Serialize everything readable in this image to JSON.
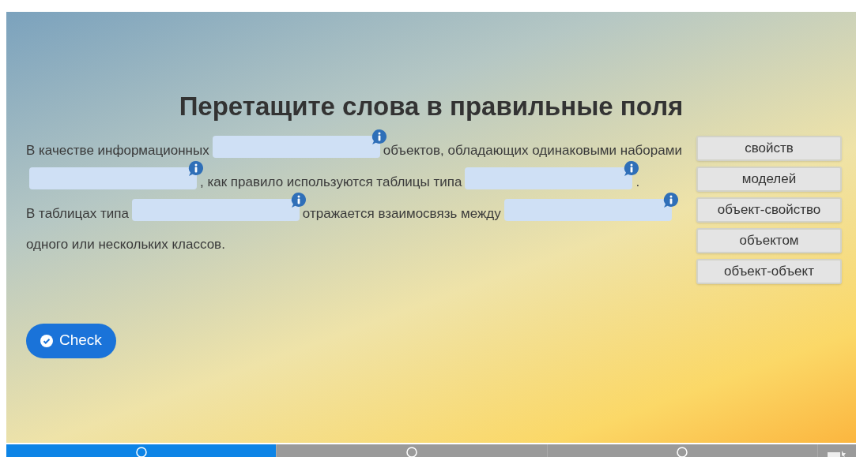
{
  "title": "Перетащите слова в правильные поля",
  "paragraphs": [
    [
      {
        "kind": "text",
        "text": "В качестве информационных"
      },
      {
        "kind": "blank"
      },
      {
        "kind": "text",
        "text": "объектов, обладающих одинаковыми наборами"
      },
      {
        "kind": "blank"
      },
      {
        "kind": "text",
        "text": ", как правило используются таблицы типа"
      },
      {
        "kind": "blank"
      },
      {
        "kind": "text",
        "text": "."
      }
    ],
    [
      {
        "kind": "text",
        "text": "В таблицах типа"
      },
      {
        "kind": "blank"
      },
      {
        "kind": "text",
        "text": "отражается взаимосвязь между"
      },
      {
        "kind": "blank"
      },
      {
        "kind": "text",
        "text": "одного или нескольких классов."
      }
    ]
  ],
  "words": [
    "свойств",
    "моделей",
    "объект-свойство",
    "объектом",
    "объект-объект"
  ],
  "check_button": "Check",
  "progress": [
    {
      "selected": true
    },
    {
      "selected": false
    },
    {
      "selected": false
    }
  ]
}
